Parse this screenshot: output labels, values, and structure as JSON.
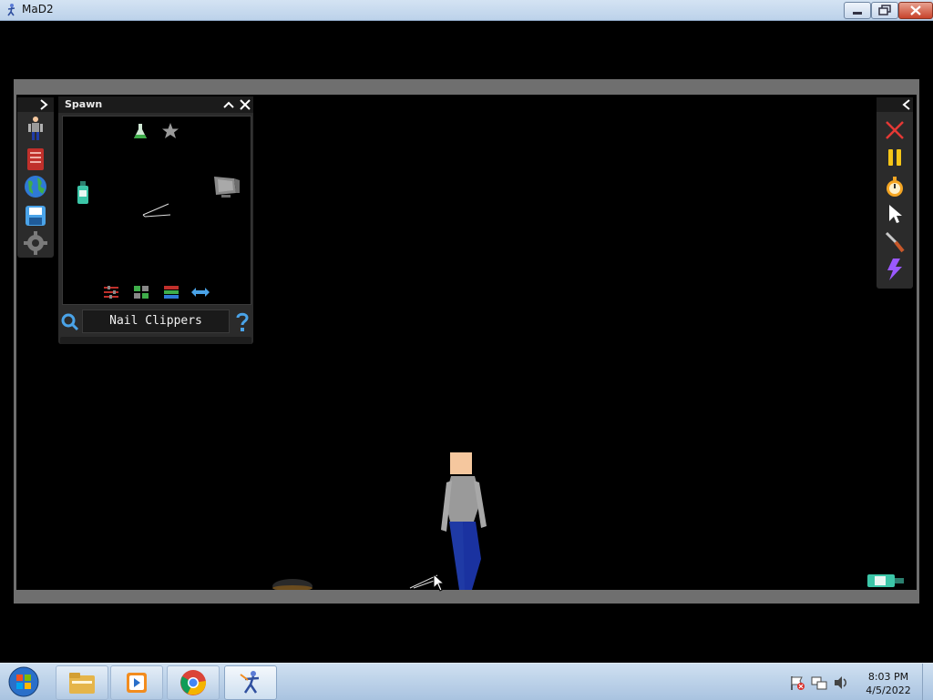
{
  "window": {
    "title": "MaD2",
    "app_icon": "mad2-figure-icon",
    "controls": [
      "minimize-icon",
      "maximize-icon",
      "close-icon"
    ]
  },
  "left_toolbar": {
    "collapse_icon": "chevron-right-icon",
    "items": [
      {
        "name": "humanoid-icon"
      },
      {
        "name": "book-icon"
      },
      {
        "name": "globe-icon"
      },
      {
        "name": "save-icon"
      },
      {
        "name": "gear-icon"
      }
    ]
  },
  "spawn_panel": {
    "title": "Spawn",
    "header_icons": [
      "chevron-up-icon",
      "close-icon"
    ],
    "items": [
      {
        "name": "flask-icon"
      },
      {
        "name": "star-icon"
      },
      {
        "name": "bottle-item"
      },
      {
        "name": "nail-clippers-item"
      },
      {
        "name": "monitor-item"
      }
    ],
    "footer_tabs": [
      "sliders-icon",
      "grid-icon",
      "layers-icon",
      "swap-arrows-icon"
    ],
    "search_icon": "search-icon",
    "selected_item": "Nail Clippers",
    "help_icon": "help-icon"
  },
  "right_toolbar": {
    "collapse_icon": "chevron-left-icon",
    "items": [
      {
        "name": "clear-icon",
        "color": "#e53935"
      },
      {
        "name": "pause-icon",
        "color": "#f5c518"
      },
      {
        "name": "stopwatch-icon",
        "color": "#f5a623"
      },
      {
        "name": "pointer-icon",
        "color": "#ffffff"
      },
      {
        "name": "knife-icon",
        "color": "#c8582a"
      },
      {
        "name": "lightning-icon",
        "color": "#9b59ff"
      }
    ]
  },
  "taskbar": {
    "start": "windows-start-icon",
    "apps": [
      "file-explorer-icon",
      "media-player-icon",
      "chrome-icon",
      "mad2-app-icon"
    ],
    "tray_icons": [
      "action-center-flag-icon",
      "network-icon",
      "volume-icon"
    ],
    "time": "8:03 PM",
    "date": "4/5/2022"
  }
}
